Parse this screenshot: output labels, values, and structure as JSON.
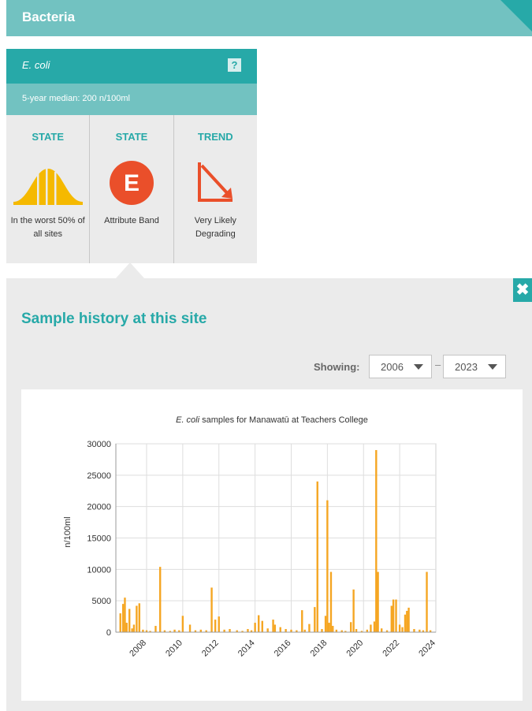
{
  "header": {
    "title": "Bacteria"
  },
  "card": {
    "title": "E. coli",
    "help_label": "?",
    "median_text": "5-year median: 200 n/100ml",
    "columns": [
      {
        "label": "STATE",
        "icon": "bell-curve-icon",
        "text": "In the worst 50% of all sites",
        "color": "#f5b900"
      },
      {
        "label": "STATE",
        "icon": "attribute-band-e-icon",
        "badge": "E",
        "text": "Attribute Band",
        "color": "#ea4f2a"
      },
      {
        "label": "TREND",
        "icon": "trend-down-arrow-icon",
        "text": "Very Likely Degrading",
        "color": "#ea4f2a"
      }
    ]
  },
  "panel": {
    "close_label": "✖",
    "title": "Sample history at this site",
    "showing_label": "Showing:",
    "from_year": "2006",
    "to_year": "2023",
    "separator": "–"
  },
  "colors": {
    "accent": "#27a9a8",
    "accent_light": "#72c2c1",
    "series": "#f5a623"
  },
  "chart_data": {
    "type": "bar",
    "title_italic": "E. coli",
    "title_rest": " samples for Manawatū at Teachers College",
    "ylabel": "n/100ml",
    "ylim": [
      0,
      30000
    ],
    "yticks": [
      0,
      5000,
      10000,
      15000,
      20000,
      25000,
      30000
    ],
    "xlim": [
      2006.3,
      2024.0
    ],
    "xticks": [
      2008,
      2010,
      2012,
      2014,
      2016,
      2018,
      2020,
      2022,
      2024
    ],
    "grid": true,
    "series": [
      {
        "color": "#f5a623",
        "x": [
          2006.55,
          2006.7,
          2006.8,
          2006.9,
          2007.05,
          2007.2,
          2007.3,
          2007.45,
          2007.6,
          2007.8,
          2008.0,
          2008.2,
          2008.5,
          2008.75,
          2009.0,
          2009.3,
          2009.55,
          2009.8,
          2010.0,
          2010.4,
          2010.7,
          2011.0,
          2011.3,
          2011.6,
          2011.8,
          2012.0,
          2012.3,
          2012.6,
          2013.0,
          2013.3,
          2013.6,
          2013.8,
          2014.0,
          2014.2,
          2014.4,
          2014.7,
          2015.0,
          2015.1,
          2015.4,
          2015.7,
          2016.0,
          2016.3,
          2016.6,
          2016.75,
          2017.0,
          2017.3,
          2017.45,
          2017.7,
          2017.9,
          2018.0,
          2018.1,
          2018.2,
          2018.3,
          2018.5,
          2018.8,
          2019.0,
          2019.3,
          2019.45,
          2019.6,
          2019.9,
          2020.2,
          2020.4,
          2020.6,
          2020.7,
          2020.8,
          2021.0,
          2021.3,
          2021.55,
          2021.65,
          2021.8,
          2022.0,
          2022.15,
          2022.3,
          2022.4,
          2022.5,
          2022.8,
          2023.1,
          2023.3,
          2023.5,
          2023.7
        ],
        "values": [
          3000,
          4500,
          5500,
          1500,
          3700,
          600,
          1200,
          4200,
          4600,
          400,
          300,
          200,
          1000,
          10400,
          300,
          200,
          400,
          300,
          2600,
          1200,
          300,
          400,
          300,
          7100,
          2000,
          2500,
          400,
          500,
          300,
          200,
          500,
          300,
          1500,
          2700,
          1800,
          600,
          2000,
          1200,
          800,
          500,
          400,
          300,
          3500,
          400,
          1300,
          4000,
          24000,
          500,
          2600,
          21000,
          1500,
          9600,
          1000,
          400,
          300,
          200,
          1600,
          6800,
          500,
          200,
          400,
          1200,
          1700,
          29000,
          9600,
          600,
          300,
          4200,
          5200,
          5200,
          1200,
          800,
          2800,
          3400,
          3900,
          500,
          400,
          300,
          9600,
          300
        ]
      }
    ]
  }
}
